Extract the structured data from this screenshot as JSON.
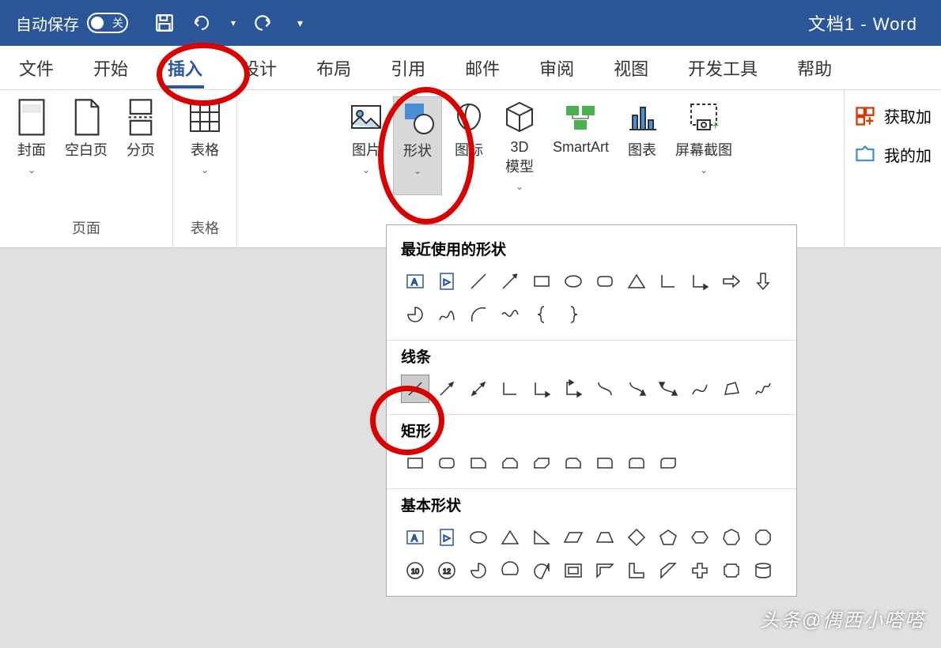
{
  "titlebar": {
    "autosave_label": "自动保存",
    "toggle_label": "关",
    "doc_title": "文档1  -  Word"
  },
  "tabs": {
    "file": "文件",
    "home": "开始",
    "insert": "插入",
    "design": "设计",
    "layout": "布局",
    "references": "引用",
    "mailings": "邮件",
    "review": "审阅",
    "view": "视图",
    "developer": "开发工具",
    "help": "帮助"
  },
  "ribbon": {
    "cover": "封面",
    "blank": "空白页",
    "break": "分页",
    "pages_group": "页面",
    "table": "表格",
    "table_group": "表格",
    "pictures": "图片",
    "shapes": "形状",
    "icons": "图标",
    "model3d": "3D\n模型",
    "smartart": "SmartArt",
    "chart": "图表",
    "screenshot": "屏幕截图",
    "get_addins": "获取加",
    "my_addins": "我的加"
  },
  "shapes_panel": {
    "recent": "最近使用的形状",
    "lines": "线条",
    "rectangles": "矩形",
    "basic": "基本形状"
  },
  "watermark": "头条@偶西小嗒嗒"
}
